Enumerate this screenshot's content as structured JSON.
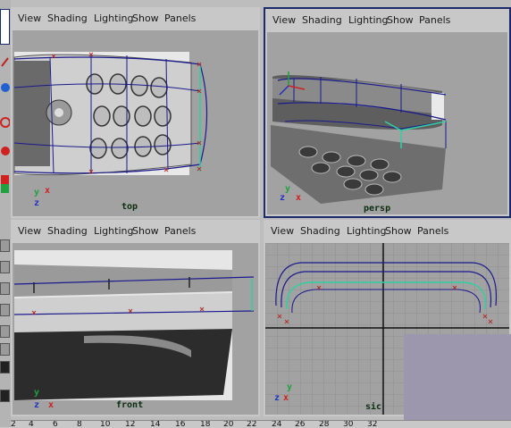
{
  "menu": [
    "View",
    "Shading",
    "Lighting",
    "Show",
    "Panels"
  ],
  "viewports": {
    "top": "top",
    "persp": "persp",
    "front": "front",
    "side": "sic"
  },
  "axes": {
    "x": "x",
    "y": "y",
    "z": "z"
  },
  "timeline": [
    "2",
    "4",
    "6",
    "8",
    "10",
    "12",
    "14",
    "16",
    "18",
    "20",
    "22",
    "24",
    "26",
    "28",
    "30",
    "32"
  ],
  "colors": {
    "active_border": "#1b2a6b",
    "viewport_bg": "#a2a2a2",
    "curve": "#1a1a8c",
    "selected": "#30d0a0"
  }
}
